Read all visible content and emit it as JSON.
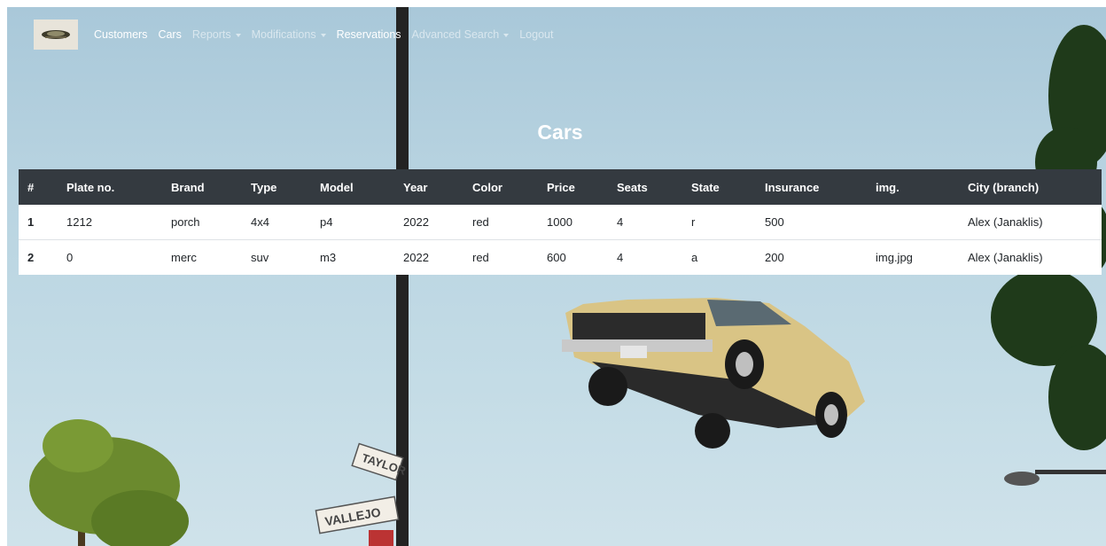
{
  "nav": {
    "items": [
      {
        "label": "Customers",
        "dropdown": false,
        "active": true
      },
      {
        "label": "Cars",
        "dropdown": false,
        "active": true
      },
      {
        "label": "Reports",
        "dropdown": true,
        "active": false
      },
      {
        "label": "Modifications",
        "dropdown": true,
        "active": false
      },
      {
        "label": "Reservations",
        "dropdown": false,
        "active": true
      },
      {
        "label": "Advanced Search",
        "dropdown": true,
        "active": false
      },
      {
        "label": "Logout",
        "dropdown": false,
        "active": false
      }
    ]
  },
  "page": {
    "title": "Cars"
  },
  "table": {
    "headers": [
      "#",
      "Plate no.",
      "Brand",
      "Type",
      "Model",
      "Year",
      "Color",
      "Price",
      "Seats",
      "State",
      "Insurance",
      "img.",
      "City (branch)"
    ],
    "rows": [
      [
        "1",
        "1212",
        "porch",
        "4x4",
        "p4",
        "2022",
        "red",
        "1000",
        "4",
        "r",
        "500",
        "",
        "Alex (Janaklis)"
      ],
      [
        "2",
        "0",
        "merc",
        "suv",
        "m3",
        "2022",
        "red",
        "600",
        "4",
        "a",
        "200",
        "img.jpg",
        "Alex (Janaklis)"
      ]
    ]
  },
  "background": {
    "sign_top": "TAYLOR",
    "sign_bottom": "VALLEJO"
  },
  "colors": {
    "table_header": "#343a40",
    "nav_active": "#ffffff",
    "sky": "#b9d4e1"
  }
}
